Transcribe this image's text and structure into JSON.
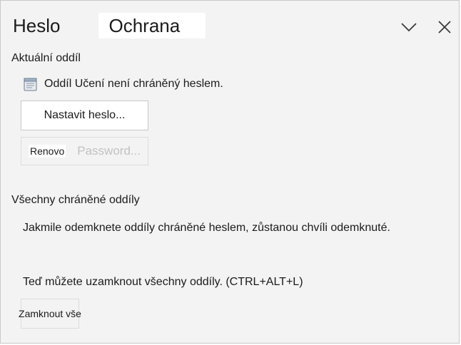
{
  "header": {
    "tab_password": "Heslo",
    "tab_protection": "Ochrana",
    "collapse_icon": "chevron-down-icon",
    "close_icon": "close-icon"
  },
  "current_section": {
    "title": "Aktuální oddíl",
    "status_icon": "notebook-section-icon",
    "status_text": "Oddíl Učení není chráněný heslem.",
    "set_password_label": "Nastavit heslo...",
    "renew_label": "Renovo",
    "renew_ghost_label": "Password..."
  },
  "all_protected": {
    "title": "Všechny chráněné oddíly",
    "info_text": "Jakmile odemknete oddíly chráněné heslem, zůstanou chvíli odemknuté.",
    "lock_info": "Teď můžete uzamknout všechny oddíly. (CTRL+ALT+L)",
    "lock_all_label": "Zamknout vše"
  }
}
